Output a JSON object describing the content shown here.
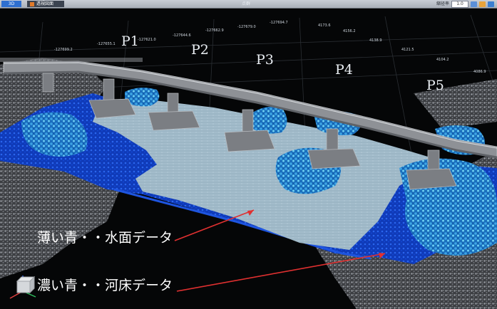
{
  "toolbar": {
    "tab_3d": "3D",
    "tab_transparency": "透視図面",
    "title": "点群",
    "ratio_label": "縮径率",
    "ratio_value": "1.0"
  },
  "scene": {
    "coordinates": [
      "-127699.2",
      "-127655.1",
      "-127621.0",
      "-127644.6",
      "-127662.9",
      "-127679.0",
      "-127694.7",
      "4173.6",
      "4156.2",
      "4138.9",
      "4121.5",
      "4104.2",
      "4086.9"
    ],
    "pier_labels": [
      "P1",
      "P2",
      "P3",
      "P4",
      "P5"
    ],
    "captions": {
      "light_blue": "薄い青・・水面データ",
      "dark_blue": "濃い青・・河床データ"
    },
    "colors": {
      "water_surface": "#9fb8c8",
      "river_bed": "#1b52d6",
      "ground": "#8a8d92",
      "arrow": "#e03030"
    }
  }
}
